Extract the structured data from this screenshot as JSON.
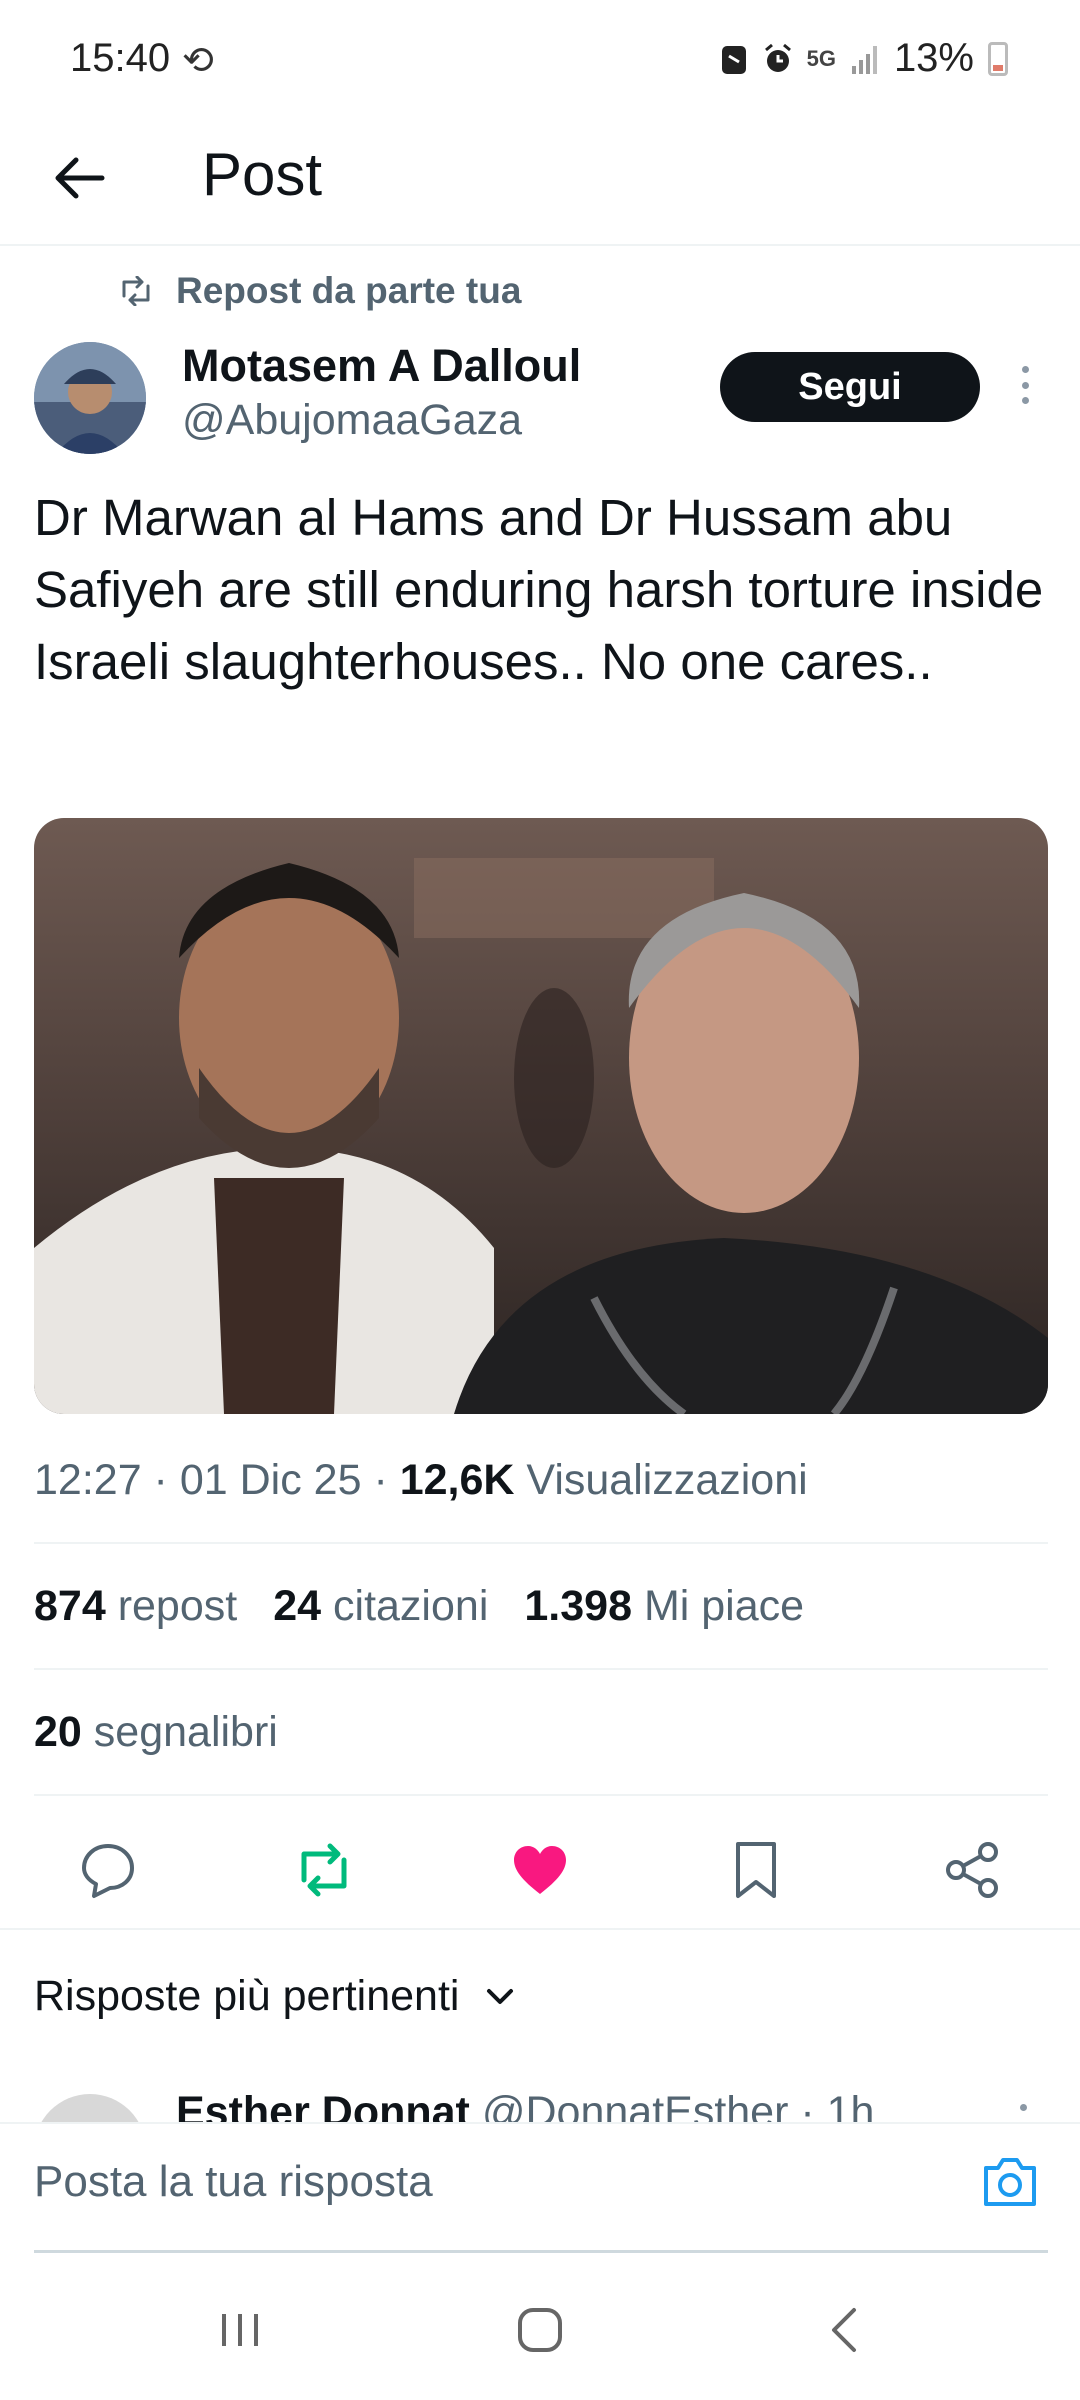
{
  "status_bar": {
    "time": "15:40",
    "network": "5G",
    "battery": "13%"
  },
  "header": {
    "title": "Post"
  },
  "post": {
    "repost_label": "Repost da parte tua",
    "author_name": "Motasem A Dalloul",
    "author_handle": "@AbujomaaGaza",
    "follow_label": "Segui",
    "text": "Dr Marwan al Hams and Dr Hussam abu Safiyeh are still enduring harsh torture inside Israeli slaughterhouses.. No one cares..",
    "time": "12:27",
    "date": "01 Dic 25",
    "views_count": "12,6K",
    "views_label": "Visualizzazioni",
    "reposts_count": "874",
    "reposts_label": "repost",
    "quotes_count": "24",
    "quotes_label": "citazioni",
    "likes_count": "1.398",
    "likes_label": "Mi piace",
    "bookmarks_count": "20",
    "bookmarks_label": "segnalibri"
  },
  "actions": {
    "reply_icon": "reply-icon",
    "repost_icon": "repost-icon",
    "like_icon": "heart-icon",
    "bookmark_icon": "bookmark-icon",
    "share_icon": "share-icon",
    "repost_color": "#00ba7c",
    "like_color": "#f91880"
  },
  "replies": {
    "sort_label": "Risposte più pertinenti",
    "first_reply_name": "Esther Donnat",
    "first_reply_meta": "@DonnatEsther · 1h"
  },
  "reply_bar": {
    "placeholder": "Posta la tua risposta"
  },
  "colors": {
    "text_primary": "#0f1419",
    "text_secondary": "#536471",
    "accent": "#1d9bf0",
    "follow_bg": "#0f1419"
  }
}
